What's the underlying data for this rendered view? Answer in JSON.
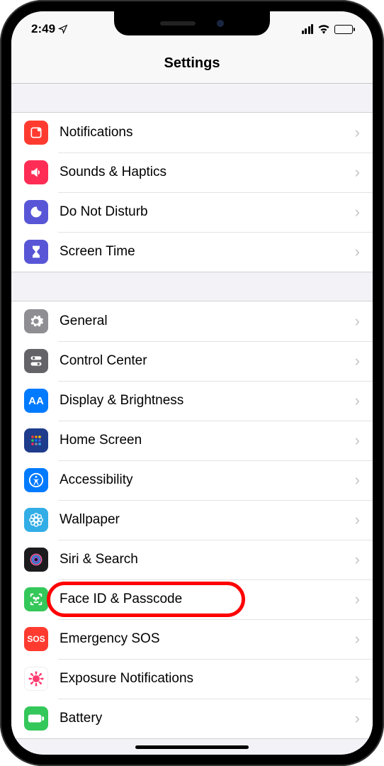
{
  "status": {
    "time": "2:49",
    "location_icon": "location-arrow"
  },
  "navbar": {
    "title": "Settings"
  },
  "groups": [
    {
      "items": [
        {
          "id": "notifications",
          "label": "Notifications",
          "icon": "notifications-icon",
          "bg": "bg-red"
        },
        {
          "id": "sounds-haptics",
          "label": "Sounds & Haptics",
          "icon": "speaker-icon",
          "bg": "bg-pink"
        },
        {
          "id": "do-not-disturb",
          "label": "Do Not Disturb",
          "icon": "moon-icon",
          "bg": "bg-purple"
        },
        {
          "id": "screen-time",
          "label": "Screen Time",
          "icon": "hourglass-icon",
          "bg": "bg-purple"
        }
      ]
    },
    {
      "items": [
        {
          "id": "general",
          "label": "General",
          "icon": "gear-icon",
          "bg": "bg-gray"
        },
        {
          "id": "control-center",
          "label": "Control Center",
          "icon": "switches-icon",
          "bg": "bg-darkgray"
        },
        {
          "id": "display-brightness",
          "label": "Display & Brightness",
          "icon": "text-size-icon",
          "bg": "bg-blue"
        },
        {
          "id": "home-screen",
          "label": "Home Screen",
          "icon": "grid-icon",
          "bg": "bg-darkblue"
        },
        {
          "id": "accessibility",
          "label": "Accessibility",
          "icon": "accessibility-icon",
          "bg": "bg-blue"
        },
        {
          "id": "wallpaper",
          "label": "Wallpaper",
          "icon": "flower-icon",
          "bg": "bg-cyan"
        },
        {
          "id": "siri-search",
          "label": "Siri & Search",
          "icon": "siri-icon",
          "bg": "bg-black"
        },
        {
          "id": "face-id-passcode",
          "label": "Face ID & Passcode",
          "icon": "faceid-icon",
          "bg": "bg-green",
          "highlighted": true
        },
        {
          "id": "emergency-sos",
          "label": "Emergency SOS",
          "icon": "sos-icon",
          "bg": "bg-sos",
          "iconText": "SOS"
        },
        {
          "id": "exposure-notifications",
          "label": "Exposure Notifications",
          "icon": "covid-icon",
          "bg": "bg-white"
        },
        {
          "id": "battery",
          "label": "Battery",
          "icon": "battery-icon",
          "bg": "bg-green"
        }
      ]
    }
  ]
}
